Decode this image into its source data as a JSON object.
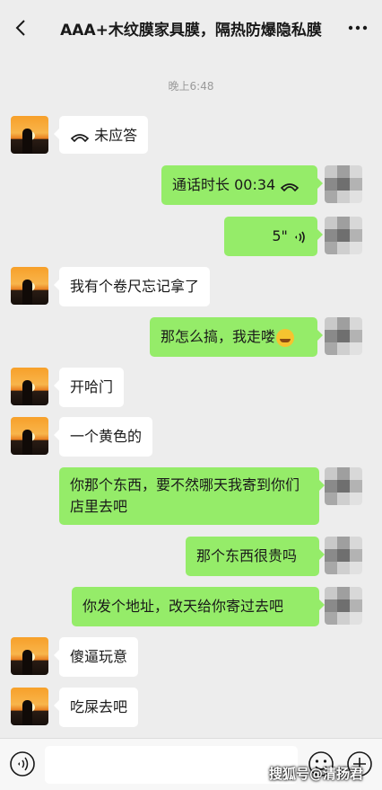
{
  "header": {
    "title": "AAA+木纹膜家具膜，隔热防爆隐私膜",
    "back_icon": "back-chevron-icon",
    "more_icon": "more-dots-icon"
  },
  "timestamp": "晚上6:48",
  "messages": [
    {
      "side": "left",
      "text": "未应答",
      "icon": "phone-icon"
    },
    {
      "side": "right",
      "text": "通话时长 00:34",
      "icon": "phone-icon"
    },
    {
      "side": "right",
      "text": "5\"",
      "icon": "voice-wave-icon"
    },
    {
      "side": "left",
      "text": "我有个卷尺忘记拿了"
    },
    {
      "side": "right",
      "text": "那怎么搞，我走喽",
      "emoji": "laughing-emoji"
    },
    {
      "side": "left",
      "text": "开哈门"
    },
    {
      "side": "left",
      "text": "一个黄色的"
    },
    {
      "side": "right",
      "text": "你那个东西，要不然哪天我寄到你们店里去吧"
    },
    {
      "side": "right",
      "text": "那个东西很贵吗"
    },
    {
      "side": "right",
      "text": "你发个地址，改天给你寄过去吧"
    },
    {
      "side": "left",
      "text": "傻逼玩意"
    },
    {
      "side": "left",
      "text": "吃屎去吧"
    }
  ],
  "input_bar": {
    "voice_icon": "voice-input-icon",
    "input_value": "",
    "emoji_icon": "emoji-icon",
    "plus_icon": "plus-icon"
  },
  "watermark": "搜狐号@清扬君",
  "colors": {
    "background": "#ededed",
    "sent_bubble": "#95ec69",
    "received_bubble": "#ffffff"
  }
}
